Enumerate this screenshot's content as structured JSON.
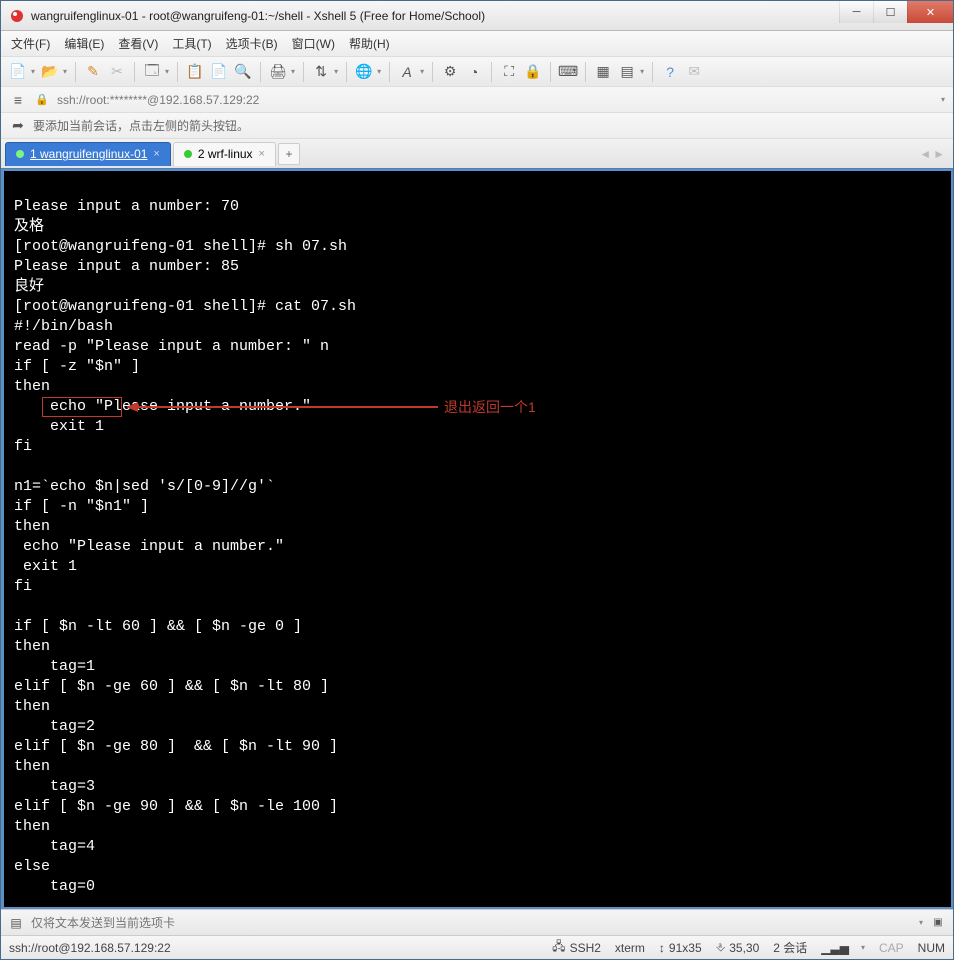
{
  "window": {
    "title": "wangruifenglinux-01 - root@wangruifeng-01:~/shell - Xshell 5 (Free for Home/School)"
  },
  "menus": {
    "file": "文件(F)",
    "edit": "编辑(E)",
    "view": "查看(V)",
    "tools": "工具(T)",
    "tabs": "选项卡(B)",
    "window": "窗口(W)",
    "help": "帮助(H)"
  },
  "addr": {
    "text": "ssh://root:********@192.168.57.129:22"
  },
  "hint": {
    "text": "要添加当前会话，点击左侧的箭头按钮。"
  },
  "tabs": {
    "tab1": "1 wangruifenglinux-01",
    "tab2": "2 wrf-linux"
  },
  "terminal": {
    "l1": "Please input a number: 70",
    "l2": "及格",
    "l3": "[root@wangruifeng-01 shell]# sh 07.sh",
    "l4": "Please input a number: 85",
    "l5": "良好",
    "l6": "[root@wangruifeng-01 shell]# cat 07.sh",
    "l7": "#!/bin/bash",
    "l8": "read -p \"Please input a number: \" n",
    "l9": "if [ -z \"$n\" ]",
    "l10": "then",
    "l11": "    echo \"Please input a number.\"",
    "l12": "    exit 1",
    "l13": "fi",
    "l14": "",
    "l15": "n1=`echo $n|sed 's/[0-9]//g'`",
    "l16": "if [ -n \"$n1\" ]",
    "l17": "then",
    "l18": " echo \"Please input a number.\"",
    "l19": " exit 1",
    "l20": "fi",
    "l21": "",
    "l22": "if [ $n -lt 60 ] && [ $n -ge 0 ]",
    "l23": "then",
    "l24": "    tag=1",
    "l25": "elif [ $n -ge 60 ] && [ $n -lt 80 ]",
    "l26": "then",
    "l27": "    tag=2",
    "l28": "elif [ $n -ge 80 ]  && [ $n -lt 90 ]",
    "l29": "then",
    "l30": "    tag=3",
    "l31": "elif [ $n -ge 90 ] && [ $n -le 100 ]",
    "l32": "then",
    "l33": "    tag=4",
    "l34": "else",
    "l35": "    tag=0"
  },
  "annotation": {
    "text": "退出返回一个1"
  },
  "inputbar": {
    "placeholder": "仅将文本发送到当前选项卡"
  },
  "status": {
    "conn": "ssh://root@192.168.57.129:22",
    "protocol": "SSH2",
    "termtype": "xterm",
    "size": "91x35",
    "cursor": "35,30",
    "sessions": "2 会话",
    "cap": "CAP",
    "num": "NUM"
  }
}
